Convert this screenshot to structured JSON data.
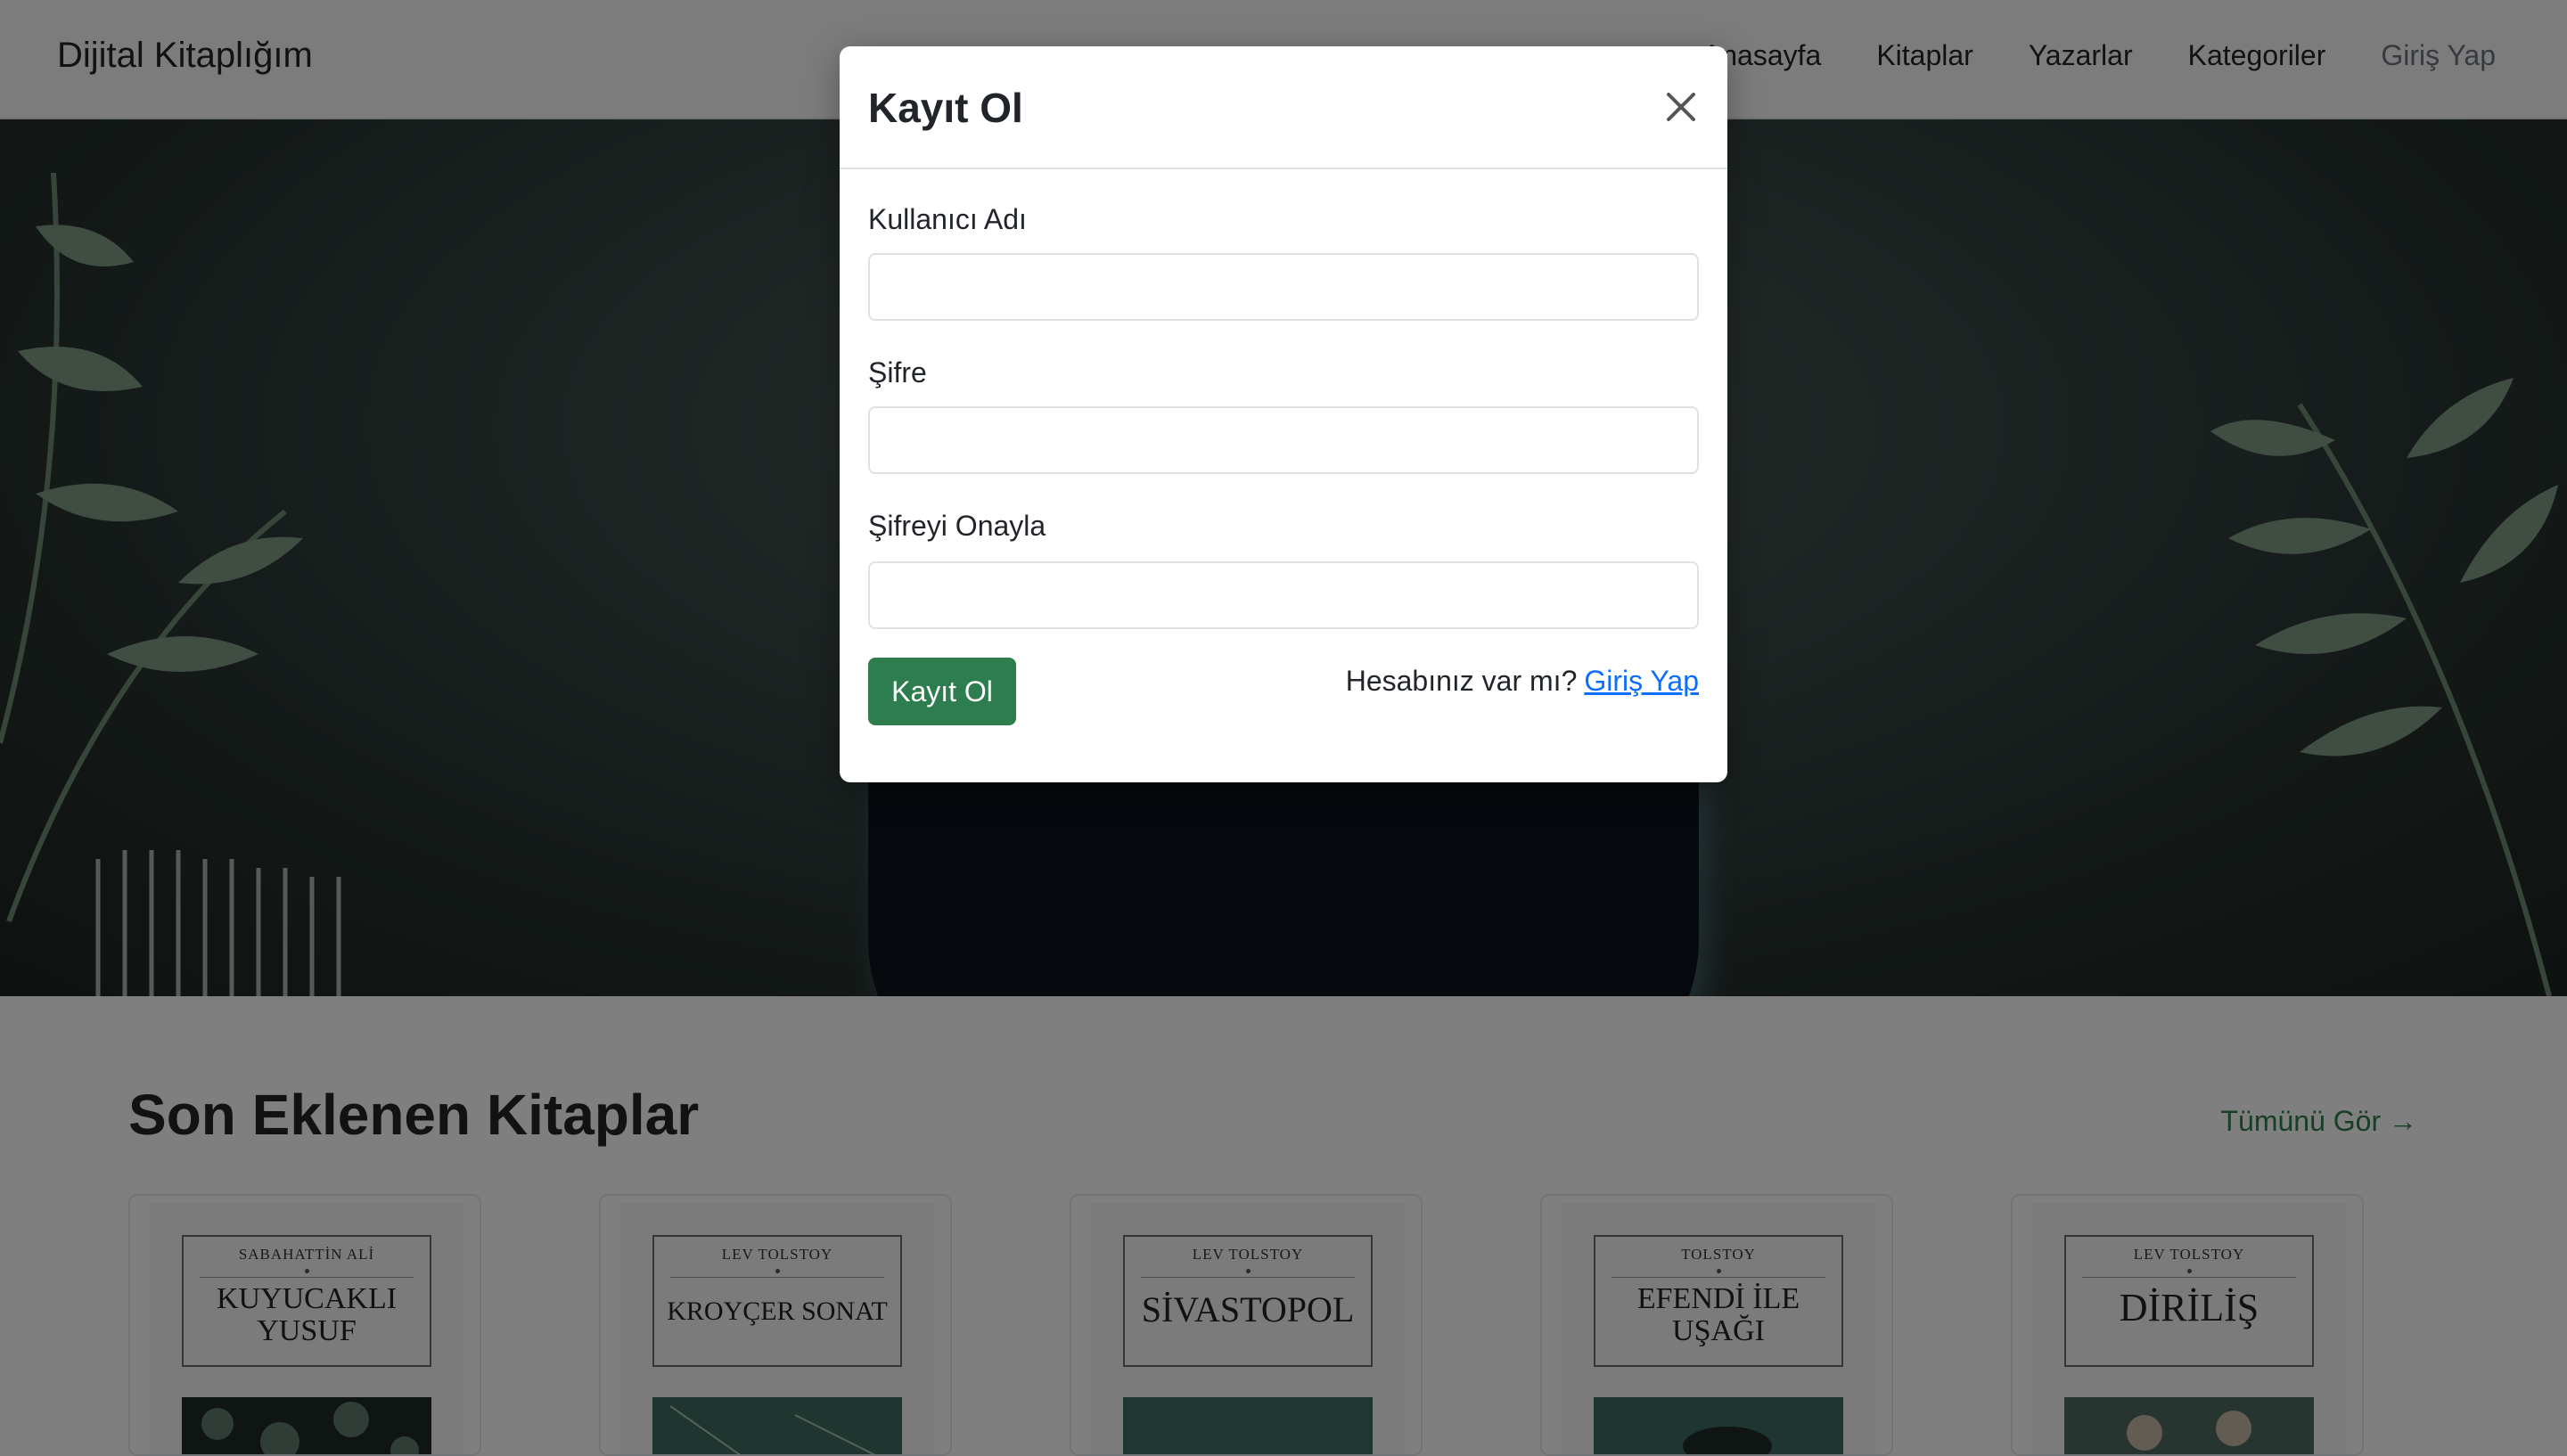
{
  "navbar": {
    "brand": "Dijital Kitaplığım",
    "links": [
      "Anasayfa",
      "Kitaplar",
      "Yazarlar",
      "Kategoriler"
    ],
    "login": "Giriş Yap"
  },
  "section": {
    "title": "Son Eklenen Kitaplar",
    "see_all": "Tümünü Gör →"
  },
  "books": [
    {
      "author": "SABAHATTİN ALİ",
      "title": "KUYUCAKLI YUSUF"
    },
    {
      "author": "LEV TOLSTOY",
      "title": "KROYÇER SONAT"
    },
    {
      "author": "LEV TOLSTOY",
      "title": "SİVASTOPOL"
    },
    {
      "author": "TOLSTOY",
      "title": "EFENDİ İLE UŞAĞI"
    },
    {
      "author": "LEV TOLSTOY",
      "title": "DİRİLİŞ"
    }
  ],
  "modal": {
    "title": "Kayıt Ol",
    "username_label": "Kullanıcı Adı",
    "username_value": "",
    "password_label": "Şifre",
    "password_value": "",
    "confirm_label": "Şifreyi Onayla",
    "confirm_value": "",
    "submit_label": "Kayıt Ol",
    "login_prompt": "Hesabınız var mı?",
    "login_link": "Giriş Yap"
  },
  "colors": {
    "accent": "#2e7d4f",
    "link": "#0d6efd",
    "overlay": "rgba(0,0,0,0.5)"
  }
}
